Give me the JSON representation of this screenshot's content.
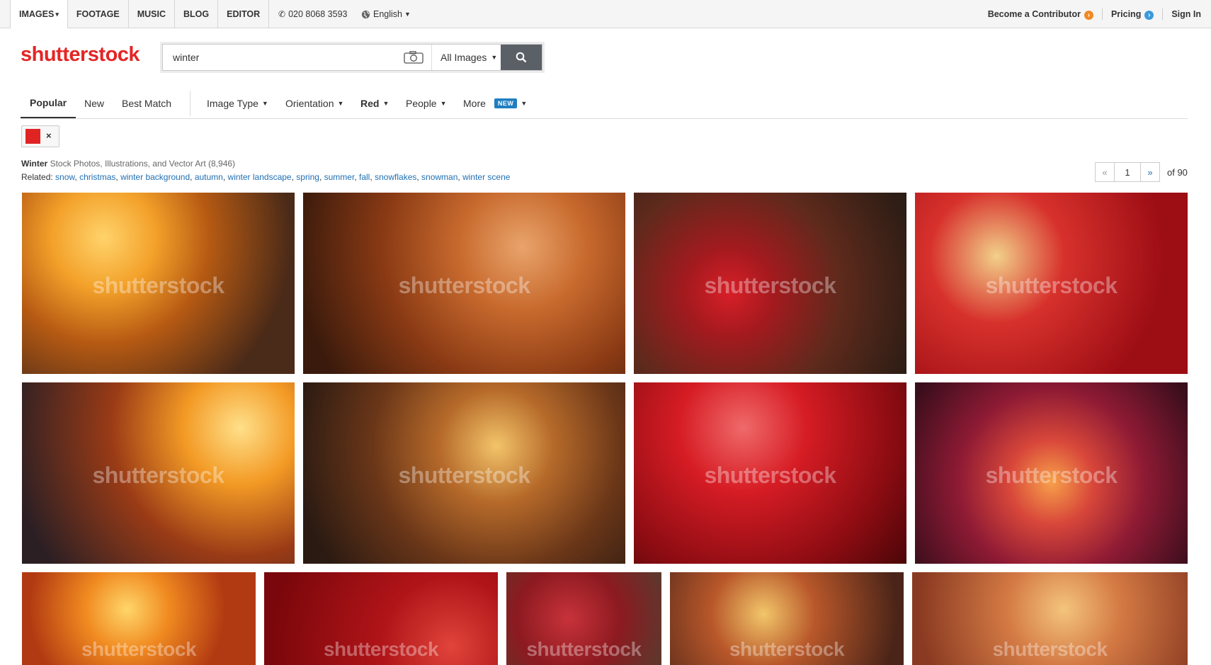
{
  "topnav": {
    "tabs": [
      {
        "label": "IMAGES",
        "caret": "▾"
      },
      {
        "label": "FOOTAGE"
      },
      {
        "label": "MUSIC"
      },
      {
        "label": "BLOG"
      },
      {
        "label": "EDITOR"
      }
    ],
    "phone": "020 8068 3593",
    "language": "English",
    "contributor": "Become a Contributor",
    "pricing": "Pricing",
    "signin": "Sign In"
  },
  "logo": "shutterstock",
  "search": {
    "value": "winter",
    "scope": "All Images"
  },
  "sort_tabs": [
    "Popular",
    "New",
    "Best Match"
  ],
  "filters": {
    "image_type": "Image Type",
    "orientation": "Orientation",
    "color": "Red",
    "people": "People",
    "more": "More",
    "new_badge": "NEW"
  },
  "color_chip": {
    "color": "#e02424",
    "remove": "×"
  },
  "results": {
    "term": "Winter",
    "desc": "Stock Photos, Illustrations, and Vector Art (8,946)",
    "related_label": "Related:",
    "related": [
      "snow",
      "christmas",
      "winter background",
      "autumn",
      "winter landscape",
      "spring",
      "summer",
      "fall",
      "snowflakes",
      "snowman",
      "winter scene"
    ]
  },
  "pagination": {
    "prev": "«",
    "page": "1",
    "next": "»",
    "total": "of 90"
  },
  "watermark": "shutterstock"
}
